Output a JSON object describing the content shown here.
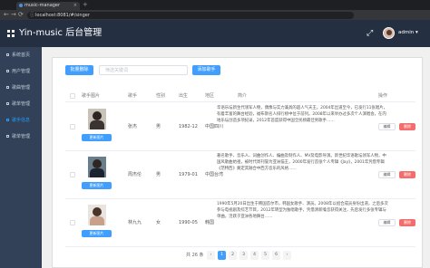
{
  "browser": {
    "tab_title": "music-manager",
    "url": "localhost:8081/#/singer",
    "close_glyph": "×",
    "newtab_glyph": "+",
    "nav": {
      "back": "←",
      "forward": "→",
      "reload": "⟳"
    }
  },
  "header": {
    "brand": "Yin-music 后台管理",
    "user": "admin ▾",
    "expand_glyph": "⤢"
  },
  "sidebar": {
    "items": [
      {
        "label": "系统首页"
      },
      {
        "label": "用户管理"
      },
      {
        "label": "歌曲管理"
      },
      {
        "label": "歌单管理"
      },
      {
        "label": "歌手信息",
        "active": true
      },
      {
        "label": "歌单管理"
      }
    ]
  },
  "toolbar": {
    "batch_delete": "批量删除",
    "search_placeholder": "筛选关键词",
    "add_singer": "添加歌手"
  },
  "table": {
    "headers": [
      "歌手图片",
      "歌手",
      "性别",
      "出生",
      "地区",
      "简介",
      "操作"
    ],
    "update_label": "更新图片",
    "edit_label": "编辑",
    "delete_label": "删除",
    "rows": [
      {
        "name": "张杰",
        "sex": "男",
        "birth": "1982-12",
        "location": "中国四川",
        "intro": "华语乐坛新生代领军人物，偶像与实力兼具的超人气天王。2004年出道至今，已发行11张唱片，有着丰富的舞台经验，福布斯名人排行榜中位于前列。2008年以来举办过多次个人演唱会，在内地乐坛创造多项纪录，2012年首度获得中国全民榜最佳男歌手……"
      },
      {
        "name": "周杰伦",
        "sex": "男",
        "birth": "1979-01",
        "location": "中国台湾",
        "intro": "著名歌手、音乐人、词曲创作人、编曲及制作人、MV及电影导演。新世纪华语歌坛领军人物，中国风歌曲始祖，被时代周刊誉为亚洲猫王，2000年发行首张个人专辑《Jay》，2001年凭借专辑《范特西》奠定其融合中西方音乐的风格……"
      },
      {
        "name": "林九九",
        "sex": "女",
        "birth": "1990-05",
        "location": "韩国",
        "intro": "1990年5月20日出生于韩国首尔市，韩国女歌手、演员。2008年以组合成员身份出道，之后多次参与电视剧及综艺节目，2012年转型为独唱歌手，凭借清新嗓音获得关注，先后发行多张专辑与单曲，活跃于亚洲各地舞台……"
      }
    ]
  },
  "pagination": {
    "total": "共 26 条",
    "prev": "‹",
    "next": "›",
    "pages": [
      "1",
      "2",
      "3",
      "4",
      "5",
      "6"
    ],
    "current": "1"
  },
  "colors": {
    "header_bg": "#242f42",
    "sidebar_bg": "#324157",
    "primary": "#409eff",
    "danger": "#f56c6c",
    "active_menu": "#20a0ff"
  }
}
